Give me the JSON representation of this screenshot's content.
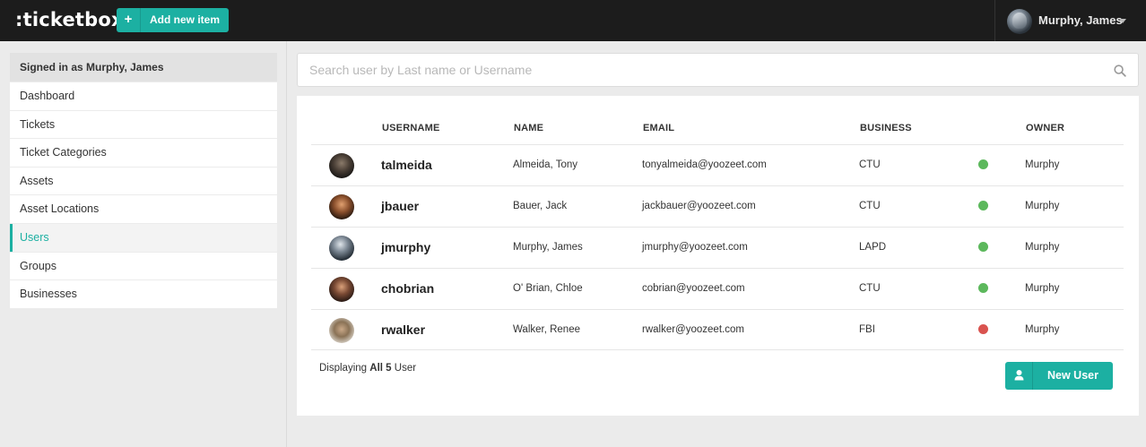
{
  "app": {
    "logo": ":ticketbox"
  },
  "header": {
    "add_new_item_icon": "+",
    "add_new_item_label": "Add new item",
    "user_name": "Murphy, James"
  },
  "sidebar": {
    "signed_in": "Signed in as Murphy, James",
    "items": [
      {
        "label": "Dashboard"
      },
      {
        "label": "Tickets"
      },
      {
        "label": "Ticket Categories"
      },
      {
        "label": "Assets"
      },
      {
        "label": "Asset Locations"
      },
      {
        "label": "Users",
        "active": true
      },
      {
        "label": "Groups"
      },
      {
        "label": "Businesses"
      }
    ]
  },
  "search": {
    "placeholder": "Search user by Last name or Username"
  },
  "table": {
    "headers": {
      "username": "USERNAME",
      "name": "NAME",
      "email": "EMAIL",
      "business": "BUSINESS",
      "owner": "OWNER"
    },
    "rows": [
      {
        "username": "talmeida",
        "name": "Almeida, Tony",
        "email": "tonyalmeida@yoozeet.com",
        "business": "CTU",
        "status": "green",
        "owner": "Murphy"
      },
      {
        "username": "jbauer",
        "name": "Bauer, Jack",
        "email": "jackbauer@yoozeet.com",
        "business": "CTU",
        "status": "green",
        "owner": "Murphy"
      },
      {
        "username": "jmurphy",
        "name": "Murphy, James",
        "email": "jmurphy@yoozeet.com",
        "business": "LAPD",
        "status": "green",
        "owner": "Murphy"
      },
      {
        "username": "chobrian",
        "name": "O' Brian, Chloe",
        "email": "cobrian@yoozeet.com",
        "business": "CTU",
        "status": "green",
        "owner": "Murphy"
      },
      {
        "username": "rwalker",
        "name": "Walker, Renee",
        "email": "rwalker@yoozeet.com",
        "business": "FBI",
        "status": "red",
        "owner": "Murphy"
      }
    ]
  },
  "footer": {
    "displaying_prefix": "Displaying",
    "displaying_count": "All 5",
    "displaying_suffix": "User",
    "new_user_label": "New User"
  },
  "colors": {
    "accent": "#1cb0a2",
    "topbar": "#1c1c1c",
    "status_green": "#5cb85c",
    "status_red": "#d9534f"
  },
  "icons": {
    "search": "search-icon",
    "new_user": "user-icon",
    "caret": "caret-down-icon"
  }
}
